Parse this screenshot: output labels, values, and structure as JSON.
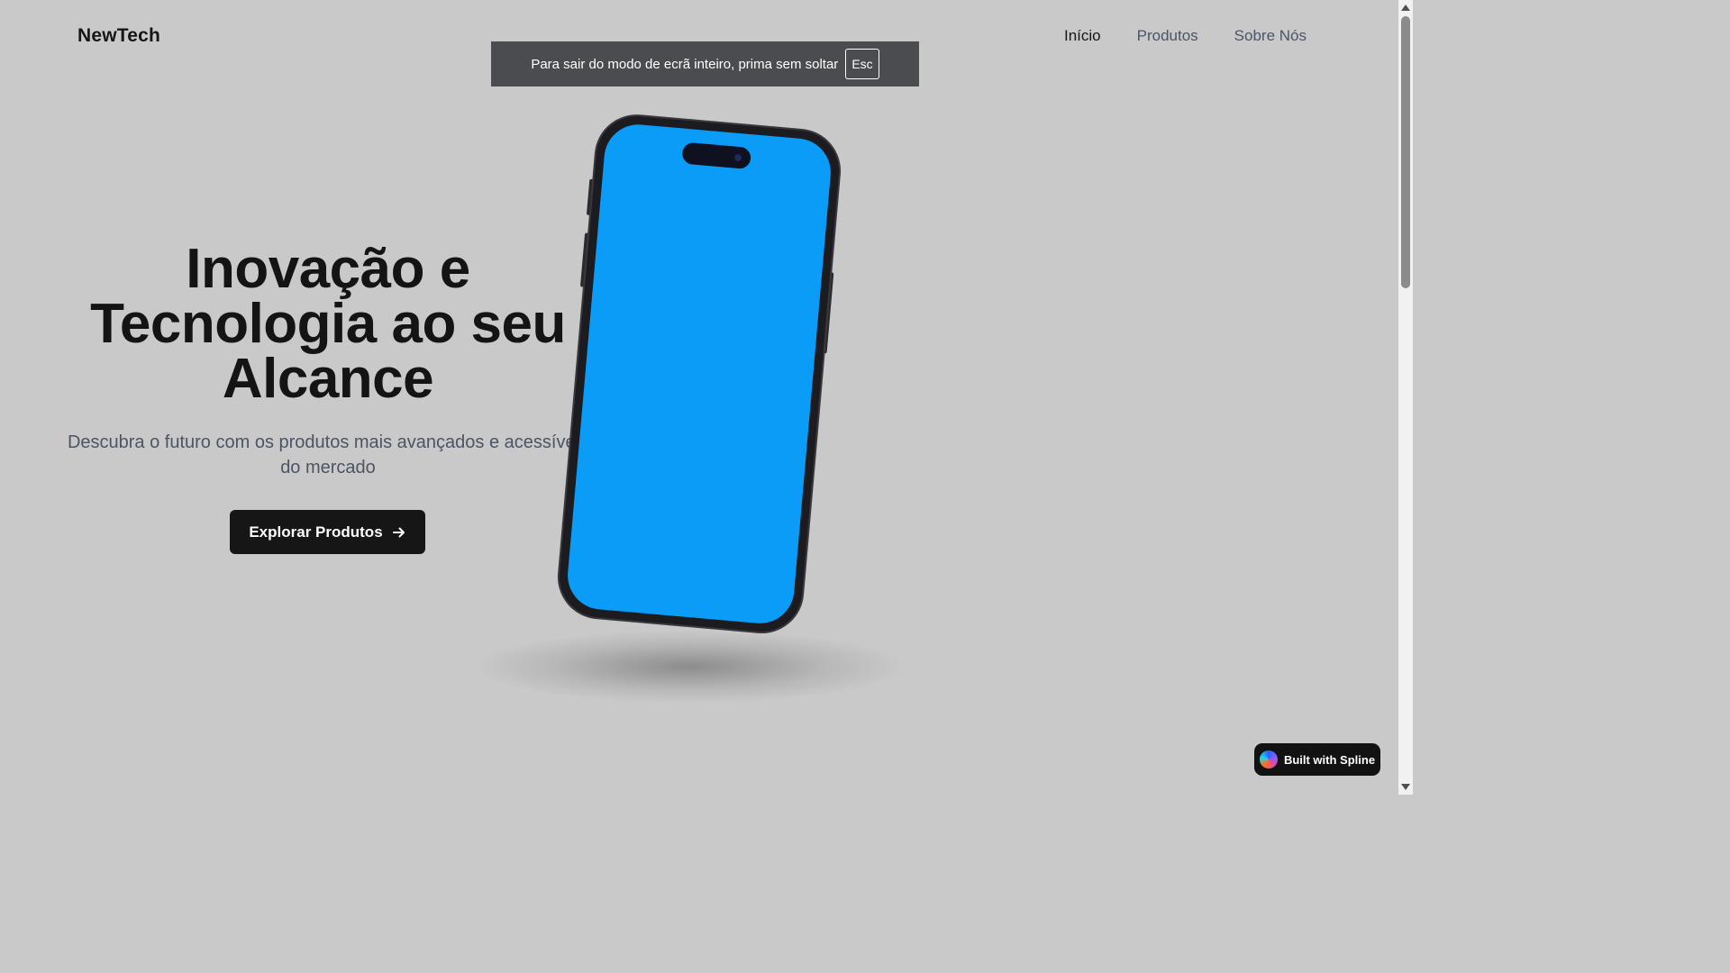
{
  "header": {
    "logo": "NewTech",
    "nav": [
      {
        "label": "Início",
        "active": true
      },
      {
        "label": "Produtos",
        "active": false
      },
      {
        "label": "Sobre Nós",
        "active": false
      }
    ]
  },
  "fullscreen_notice": {
    "text": "Para sair do modo de ecrã inteiro, prima sem soltar",
    "key": "Esc"
  },
  "hero": {
    "title_line1": "Inovação e",
    "title_line2": "Tecnologia ao seu",
    "title_line3": "Alcance",
    "subtitle_line1": "Descubra o futuro com os produtos mais avançados e acessíveis",
    "subtitle_line2": "do mercado",
    "cta_label": "Explorar Produtos",
    "cta_icon": "arrow-right-icon"
  },
  "phone": {
    "screen_color": "#0a9cf7",
    "frame_color": "#1c1b1f"
  },
  "badge": {
    "label": "Built with Spline",
    "icon": "spline-logo-icon"
  },
  "colors": {
    "background": "#c9c9c9",
    "text_dark": "#141414",
    "text_muted": "#4b5563",
    "button_bg": "#161616"
  }
}
